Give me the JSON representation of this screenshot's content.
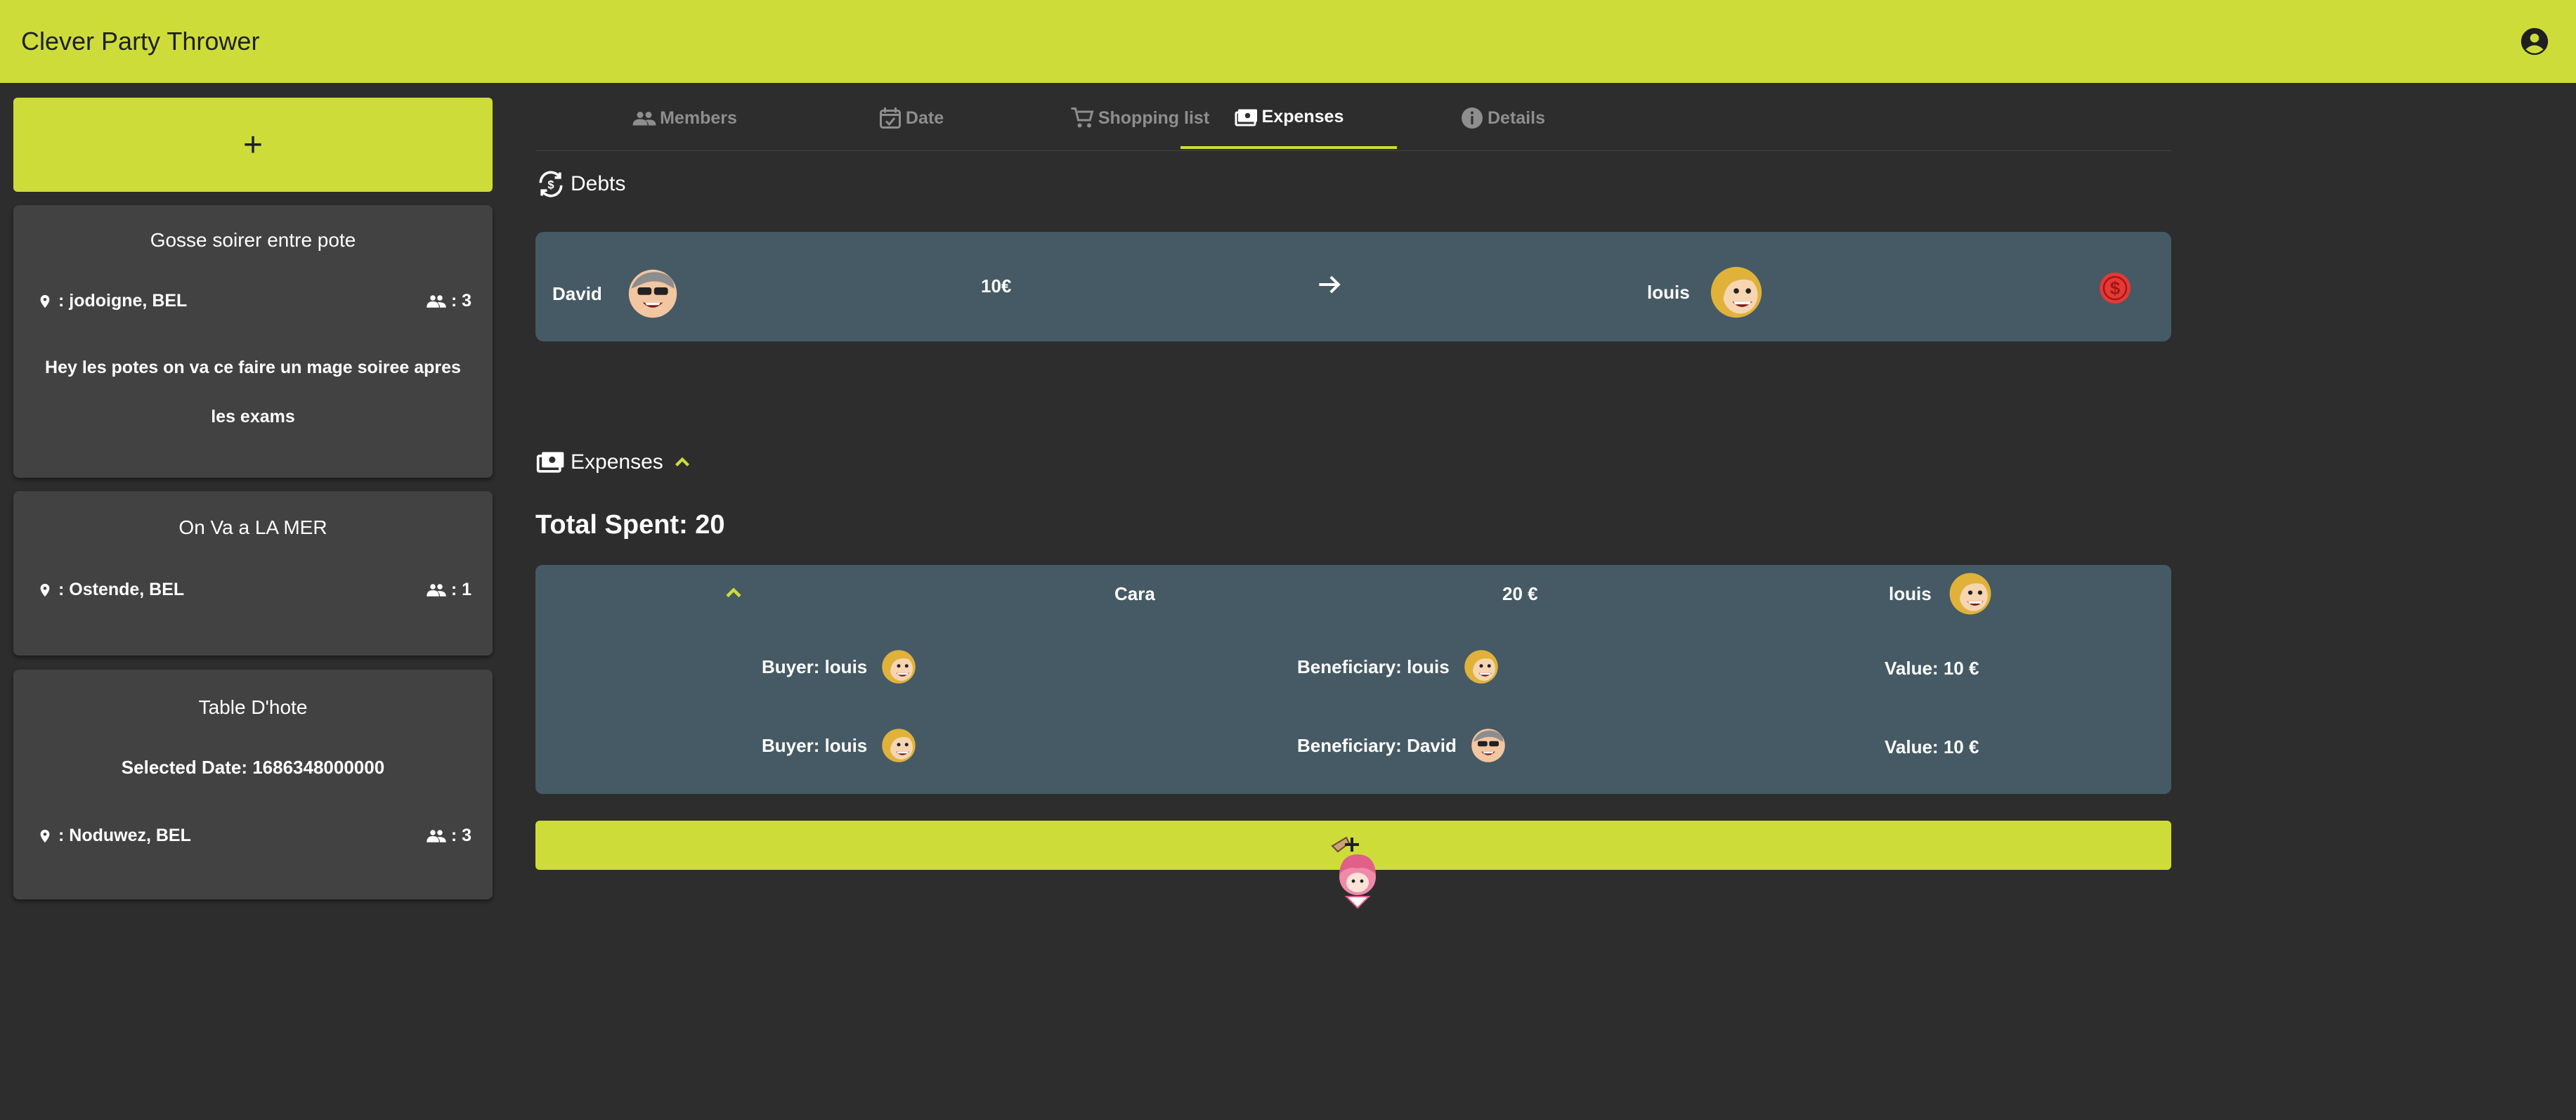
{
  "app": {
    "title": "Clever Party Thrower"
  },
  "sidebar": {
    "add_label": "+",
    "parties": [
      {
        "name": "Gosse soirer entre pote",
        "location": ": jodoigne, BEL",
        "members": ": 3",
        "description": "Hey les potes on va ce faire un mage soiree apres les exams"
      },
      {
        "name": "On Va a LA MER",
        "location": ": Ostende, BEL",
        "members": ": 1"
      },
      {
        "name": "Table D'hote",
        "selected_date": "Selected Date: 1686348000000",
        "location": ": Noduwez, BEL",
        "members": ": 3"
      }
    ]
  },
  "tabs": [
    {
      "label": "Members",
      "icon": "people-icon"
    },
    {
      "label": "Date",
      "icon": "calendar-check-icon"
    },
    {
      "label": "Shopping list",
      "icon": "cart-icon"
    },
    {
      "label": "Expenses",
      "icon": "money-icon",
      "active": true
    },
    {
      "label": "Details",
      "icon": "info-icon"
    }
  ],
  "debts": {
    "title": "Debts",
    "items": [
      {
        "from": "David",
        "amount": "10€",
        "to": "louis"
      }
    ]
  },
  "expenses": {
    "title": "Expenses",
    "total": "Total Spent: 20",
    "items": [
      {
        "name": "Cara",
        "amount": "20 €",
        "buyer": "louis",
        "details": [
          {
            "buyer": "Buyer: louis",
            "beneficiary": "Beneficiary: louis",
            "value": "Value: 10 €"
          },
          {
            "buyer": "Buyer: louis",
            "beneficiary": "Beneficiary: David",
            "value": "Value: 10 €"
          }
        ]
      }
    ],
    "add_label": "+"
  },
  "colors": {
    "accent": "#cddc39",
    "card": "#455a64",
    "background": "#2d2d2d",
    "sidebar_card": "#424242",
    "pay": "#e53935"
  }
}
